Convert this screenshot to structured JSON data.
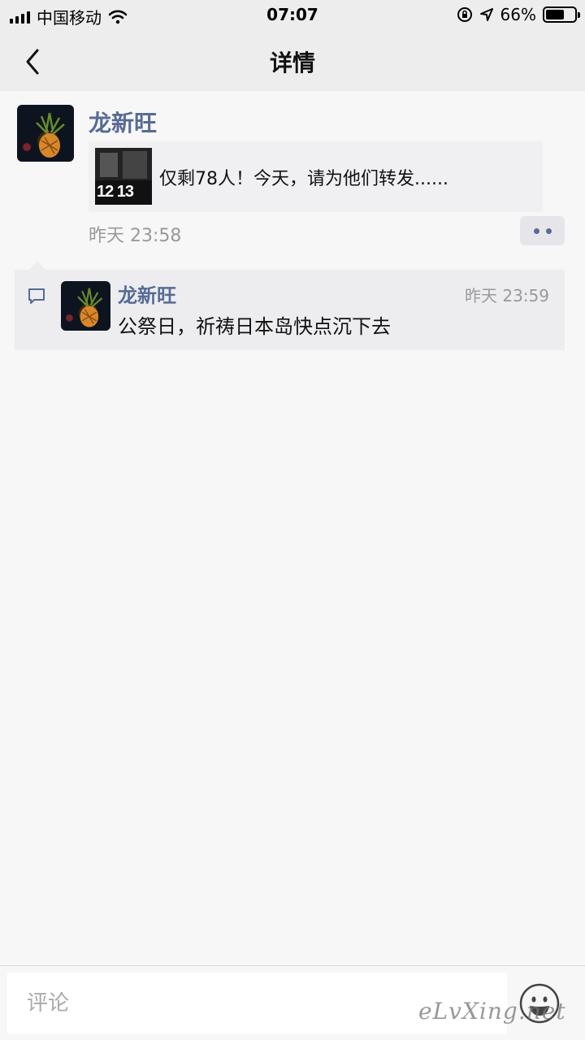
{
  "status_bar": {
    "carrier": "中国移动",
    "time": "07:07",
    "battery": "66%",
    "battery_level": 0.66
  },
  "nav": {
    "title": "详情"
  },
  "post": {
    "author": "龙新旺",
    "link_title": "仅剩78人！今天，请为他们转发......",
    "link_thumb_text": "12 13",
    "time": "昨天 23:58"
  },
  "comments": [
    {
      "author": "龙新旺",
      "time": "昨天 23:59",
      "text": "公祭日，祈祷日本岛快点沉下去"
    }
  ],
  "input": {
    "placeholder": "评论"
  },
  "watermark": "eLvXing.net",
  "colors": {
    "link_blue": "#576b95",
    "timestamp_gray": "#999999"
  },
  "icons": [
    "signal-icon",
    "wifi-icon",
    "orientation-lock-icon",
    "location-icon",
    "battery-icon",
    "back-icon",
    "more-dots-icon",
    "comment-icon",
    "emoji-icon"
  ]
}
